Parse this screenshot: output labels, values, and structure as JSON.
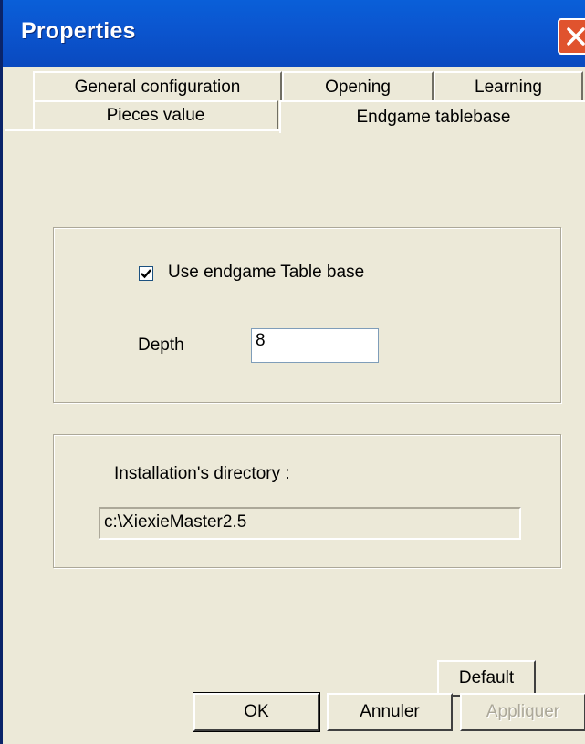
{
  "window": {
    "title": "Properties"
  },
  "tabs": {
    "row1": [
      "General configuration",
      "Opening",
      "Learning"
    ],
    "row2": [
      "Pieces value",
      "Endgame tablebase"
    ]
  },
  "panel": {
    "use_tablebase_label": "Use endgame Table base",
    "use_tablebase_checked": true,
    "depth_label": "Depth",
    "depth_value": "8",
    "install_dir_label": "Installation's directory :",
    "install_dir_value": "c:\\XiexieMaster2.5",
    "default_button": "Default"
  },
  "buttons": {
    "ok": "OK",
    "cancel": "Annuler",
    "apply": "Appliquer"
  },
  "icons": {
    "close": "close-icon",
    "check": "checkmark-icon"
  }
}
